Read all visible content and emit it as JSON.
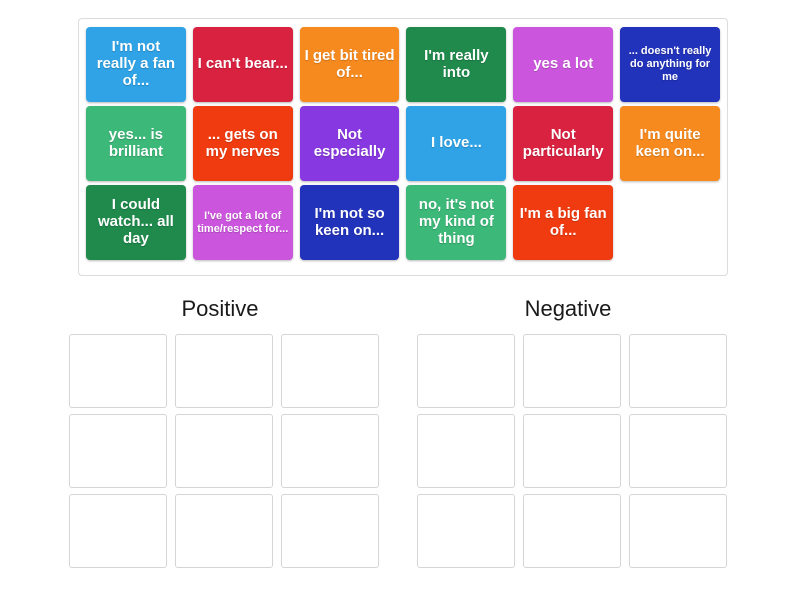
{
  "activity": {
    "type": "group-sort",
    "tile_bank": {
      "name": "draggable-tile-bank",
      "rows": [
        [
          {
            "label": "I'm not really a fan of...",
            "color": "#2fa3e6",
            "size": "normal"
          },
          {
            "label": "I can't bear...",
            "color": "#d92140",
            "size": "normal"
          },
          {
            "label": "I get bit tired of...",
            "color": "#f68a1e",
            "size": "normal"
          },
          {
            "label": "I'm really into",
            "color": "#1f8a4c",
            "size": "normal"
          },
          {
            "label": "yes a lot",
            "color": "#cc55dd",
            "size": "normal"
          },
          {
            "label": "... doesn't really do anything for me",
            "color": "#2233bb",
            "size": "small"
          }
        ],
        [
          {
            "label": "yes... is brilliant",
            "color": "#3cb878",
            "size": "normal"
          },
          {
            "label": "... gets on my nerves",
            "color": "#f03b10",
            "size": "normal"
          },
          {
            "label": "Not especially",
            "color": "#8838e0",
            "size": "normal"
          },
          {
            "label": "I love...",
            "color": "#2fa3e6",
            "size": "normal"
          },
          {
            "label": "Not particularly",
            "color": "#d92140",
            "size": "normal"
          },
          {
            "label": "I'm quite keen on...",
            "color": "#f68a1e",
            "size": "normal"
          }
        ],
        [
          {
            "label": "I could watch... all day",
            "color": "#1f8a4c",
            "size": "normal"
          },
          {
            "label": "I've got a lot of time/respect for...",
            "color": "#cc55dd",
            "size": "small"
          },
          {
            "label": "I'm not so keen on...",
            "color": "#2233bb",
            "size": "normal"
          },
          {
            "label": "no, it's not my kind of thing",
            "color": "#3cb878",
            "size": "normal"
          },
          {
            "label": "I'm a big fan of...",
            "color": "#f03b10",
            "size": "normal"
          },
          {
            "label": "",
            "color": "transparent",
            "size": "empty"
          }
        ]
      ]
    },
    "groups": [
      {
        "heading": "Positive",
        "slots": [
          "",
          "",
          "",
          "",
          "",
          "",
          "",
          "",
          ""
        ]
      },
      {
        "heading": "Negative",
        "slots": [
          "",
          "",
          "",
          "",
          "",
          "",
          "",
          "",
          ""
        ]
      }
    ]
  }
}
